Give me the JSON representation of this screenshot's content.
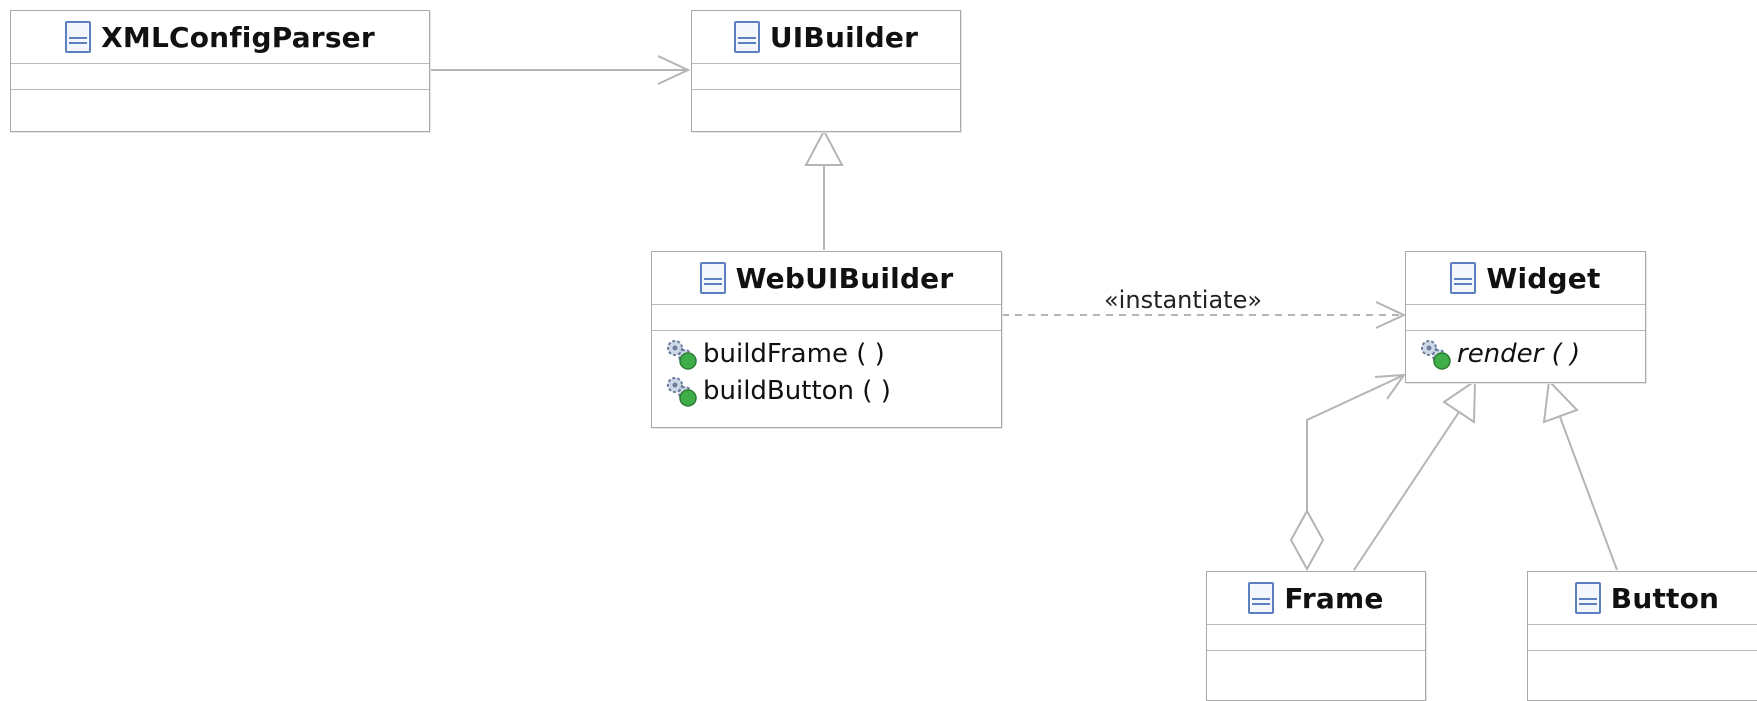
{
  "classes": {
    "xmlconfigparser": {
      "name": "XMLConfigParser"
    },
    "uibuilder": {
      "name": "UIBuilder"
    },
    "webuibuilder": {
      "name": "WebUIBuilder",
      "operations": [
        "buildFrame ( )",
        "buildButton ( )"
      ]
    },
    "widget": {
      "name": "Widget",
      "operations": [
        "render ( )"
      ]
    },
    "frame": {
      "name": "Frame"
    },
    "button": {
      "name": "Button"
    }
  },
  "relations": {
    "instantiate_label": "«instantiate»"
  },
  "colors": {
    "border": "#a9a9a9",
    "edge": "#b5b5b5",
    "icon_blue": "#5b7fbf",
    "method_green": "#3fae49"
  }
}
